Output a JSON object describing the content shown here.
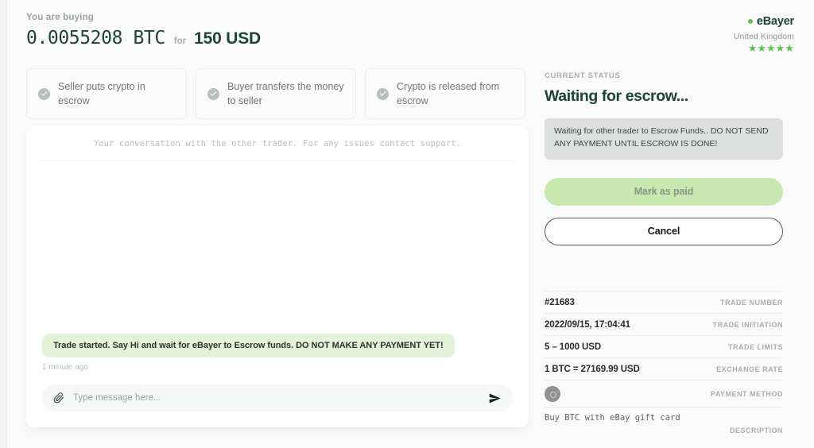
{
  "header": {
    "buying_label": "You are buying",
    "amount_crypto": "0.0055208 BTC",
    "for_label": "for",
    "amount_fiat": "150 USD"
  },
  "brand": {
    "name": "eBayer",
    "country": "United Kingdom",
    "stars": "★★★★★"
  },
  "steps": [
    {
      "label": "Seller puts crypto in escrow"
    },
    {
      "label": "Buyer transfers the money to seller"
    },
    {
      "label": "Crypto is released from escrow"
    }
  ],
  "chat": {
    "header_note": "Your conversation with the other trader. For any issues contact support.",
    "messages": [
      {
        "text": "Trade started. Say Hi and wait for eBayer to Escrow funds. DO NOT MAKE ANY PAYMENT YET!",
        "time": "1 minute ago"
      }
    ],
    "input_placeholder": "Type message here...",
    "input_value": ""
  },
  "status": {
    "label": "CURRENT STATUS",
    "title": "Waiting for escrow...",
    "notice": "Waiting for other trader to Escrow Funds.. DO NOT SEND ANY PAYMENT UNTIL ESCROW IS DONE!",
    "mark_as_paid_label": "Mark as paid",
    "cancel_label": "Cancel"
  },
  "details": {
    "trade_number": {
      "value": "#21683",
      "key": "TRADE NUMBER"
    },
    "trade_initiation": {
      "value": "2022/09/15, 17:04:41",
      "key": "TRADE INITIATION"
    },
    "trade_limits": {
      "value": "5 – 1000 USD",
      "key": "TRADE LIMITS"
    },
    "exchange_rate": {
      "value": "1 BTC = 27169.99 USD",
      "key": "EXCHANGE RATE"
    },
    "payment_method": {
      "key": "PAYMENT METHOD"
    },
    "description": {
      "value": "Buy BTC with eBay gift card",
      "key": "DESCRIPTION"
    }
  },
  "colors": {
    "brand_green": "#6cc24a",
    "star_green": "#5ec252",
    "dark_green": "#1d4435",
    "bubble_green": "#e3f3d8",
    "paid_button": "#c7e8ae"
  }
}
